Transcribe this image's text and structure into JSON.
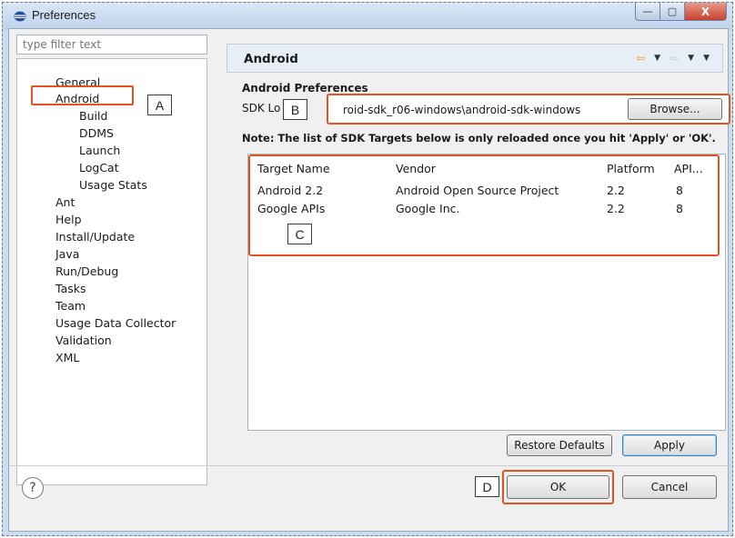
{
  "window": {
    "title": "Preferences",
    "controls": {
      "minimize": "—",
      "maximize": "▢",
      "close": "X"
    }
  },
  "sidebar": {
    "filter_placeholder": "type filter text",
    "items": [
      {
        "label": "General"
      },
      {
        "label": "Android"
      },
      {
        "label": "Build"
      },
      {
        "label": "DDMS"
      },
      {
        "label": "Launch"
      },
      {
        "label": "LogCat"
      },
      {
        "label": "Usage Stats"
      },
      {
        "label": "Ant"
      },
      {
        "label": "Help"
      },
      {
        "label": "Install/Update"
      },
      {
        "label": "Java"
      },
      {
        "label": "Run/Debug"
      },
      {
        "label": "Tasks"
      },
      {
        "label": "Team"
      },
      {
        "label": "Usage Data Collector"
      },
      {
        "label": "Validation"
      },
      {
        "label": "XML"
      }
    ]
  },
  "main": {
    "title": "Android",
    "section": "Android Preferences",
    "sdk_location_label": "SDK Lo",
    "sdk_location_value": "roid-sdk_r06-windows\\android-sdk-windows",
    "browse_label": "Browse...",
    "note": "Note: The list of SDK Targets below is only reloaded once you hit 'Apply' or 'OK'.",
    "table": {
      "columns": [
        "Target Name",
        "Vendor",
        "Platform",
        "API..."
      ],
      "rows": [
        [
          "Android 2.2",
          "Android Open Source Project",
          "2.2",
          "8"
        ],
        [
          "Google APIs",
          "Google Inc.",
          "2.2",
          "8"
        ]
      ]
    },
    "restore_defaults_label": "Restore Defaults",
    "apply_label": "Apply"
  },
  "footer": {
    "help_icon": "?",
    "ok_label": "OK",
    "cancel_label": "Cancel"
  },
  "callouts": {
    "a": "A",
    "b": "B",
    "c": "C",
    "d": "D"
  },
  "colors": {
    "highlight": "#e2541e",
    "accent_arrow": "#e0a020"
  }
}
